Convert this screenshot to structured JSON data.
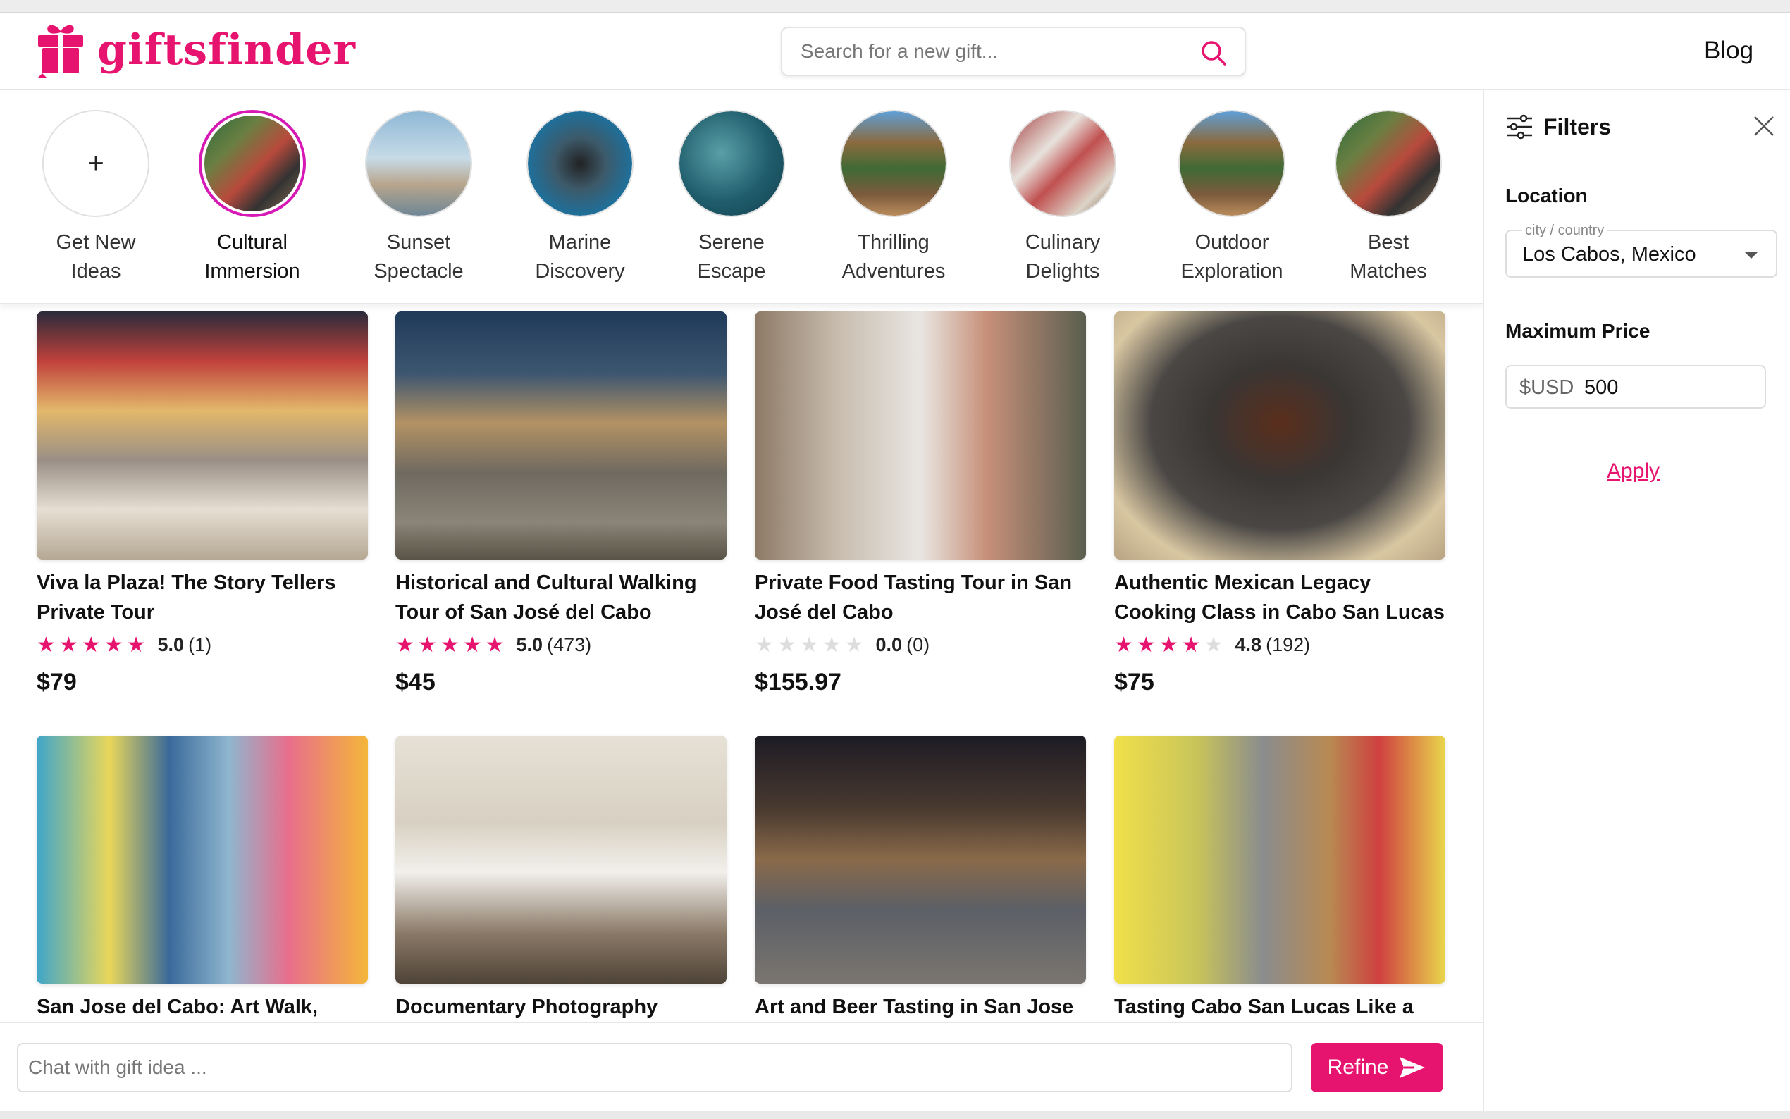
{
  "app": {
    "logo_text": "giftsfinder",
    "blog_link": "Blog"
  },
  "search": {
    "placeholder": "Search for a new gift..."
  },
  "ideas": [
    {
      "label_line1": "Get New",
      "label_line2": "Ideas"
    },
    {
      "label_line1": "Cultural",
      "label_line2": "Immersion"
    },
    {
      "label_line1": "Sunset",
      "label_line2": "Spectacle"
    },
    {
      "label_line1": "Marine",
      "label_line2": "Discovery"
    },
    {
      "label_line1": "Serene",
      "label_line2": "Escape"
    },
    {
      "label_line1": "Thrilling",
      "label_line2": "Adventures"
    },
    {
      "label_line1": "Culinary",
      "label_line2": "Delights"
    },
    {
      "label_line1": "Outdoor",
      "label_line2": "Exploration"
    },
    {
      "label_line1": "Best",
      "label_line2": "Matches"
    }
  ],
  "filters": {
    "title": "Filters",
    "location_label": "Location",
    "location_field_label": "city / country",
    "location_value": "Los Cabos, Mexico",
    "price_label": "Maximum Price",
    "price_prefix": "$USD",
    "price_value": "500",
    "apply_label": "Apply"
  },
  "cards": [
    {
      "title": "Viva la Plaza! The Story Tellers Private Tour",
      "rating": "5.0",
      "reviews": "(1)",
      "stars": 5,
      "price": "$79"
    },
    {
      "title": "Historical and Cultural Walking Tour of San José del Cabo",
      "rating": "5.0",
      "reviews": "(473)",
      "stars": 5,
      "price": "$45"
    },
    {
      "title": "Private Food Tasting Tour in San José del Cabo",
      "rating": "0.0",
      "reviews": "(0)",
      "stars": 0,
      "price": "$155.97"
    },
    {
      "title": "Authentic Mexican Legacy Cooking Class in Cabo San Lucas",
      "rating": "4.8",
      "reviews": "(192)",
      "stars": 4,
      "price": "$75"
    },
    {
      "title": "San Jose del Cabo: Art Walk, Bajas"
    },
    {
      "title": "Documentary Photography Session"
    },
    {
      "title": "Art and Beer Tasting in San Jose del"
    },
    {
      "title": "Tasting Cabo San Lucas Like a"
    }
  ],
  "chat": {
    "placeholder": "Chat with gift idea ...",
    "refine_label": "Refine"
  },
  "colors": {
    "brand": "#e6136f",
    "selected_ring": "#d619b5"
  }
}
